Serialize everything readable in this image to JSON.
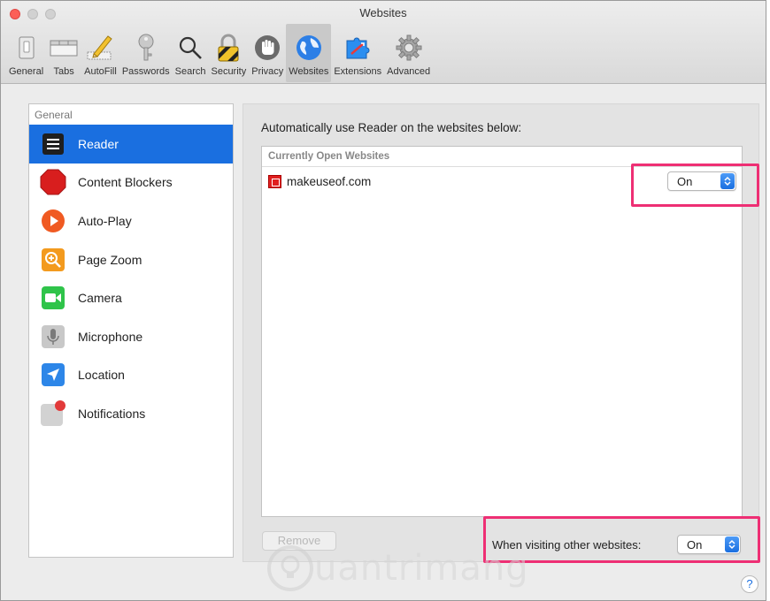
{
  "window": {
    "title": "Websites"
  },
  "toolbar": {
    "tabs": [
      {
        "label": "General",
        "icon": "general-icon"
      },
      {
        "label": "Tabs",
        "icon": "tabs-icon"
      },
      {
        "label": "AutoFill",
        "icon": "autofill-pencil-icon"
      },
      {
        "label": "Passwords",
        "icon": "key-icon"
      },
      {
        "label": "Search",
        "icon": "magnifier-icon"
      },
      {
        "label": "Security",
        "icon": "padlock-icon"
      },
      {
        "label": "Privacy",
        "icon": "hand-icon"
      },
      {
        "label": "Websites",
        "icon": "globe-icon",
        "active": true
      },
      {
        "label": "Extensions",
        "icon": "puzzle-icon"
      },
      {
        "label": "Advanced",
        "icon": "gear-icon"
      }
    ]
  },
  "sidebar": {
    "section_label": "General",
    "items": [
      {
        "label": "Reader",
        "icon": "reader-icon",
        "selected": true
      },
      {
        "label": "Content Blockers",
        "icon": "stop-sign-icon"
      },
      {
        "label": "Auto-Play",
        "icon": "play-icon"
      },
      {
        "label": "Page Zoom",
        "icon": "zoom-icon"
      },
      {
        "label": "Camera",
        "icon": "camera-icon"
      },
      {
        "label": "Microphone",
        "icon": "microphone-icon"
      },
      {
        "label": "Location",
        "icon": "location-arrow-icon"
      },
      {
        "label": "Notifications",
        "icon": "notifications-icon"
      }
    ]
  },
  "main": {
    "heading": "Automatically use Reader on the websites below:",
    "list_header": "Currently Open Websites",
    "websites": [
      {
        "domain": "makeuseof.com",
        "setting": "On"
      }
    ],
    "remove_label": "Remove",
    "other_websites_label": "When visiting other websites:",
    "other_websites_value": "On"
  },
  "colors": {
    "accent": "#1a6fe0",
    "highlight": "#ee2f74"
  },
  "help_label": "?",
  "watermark": {
    "text": "uantrimang"
  }
}
